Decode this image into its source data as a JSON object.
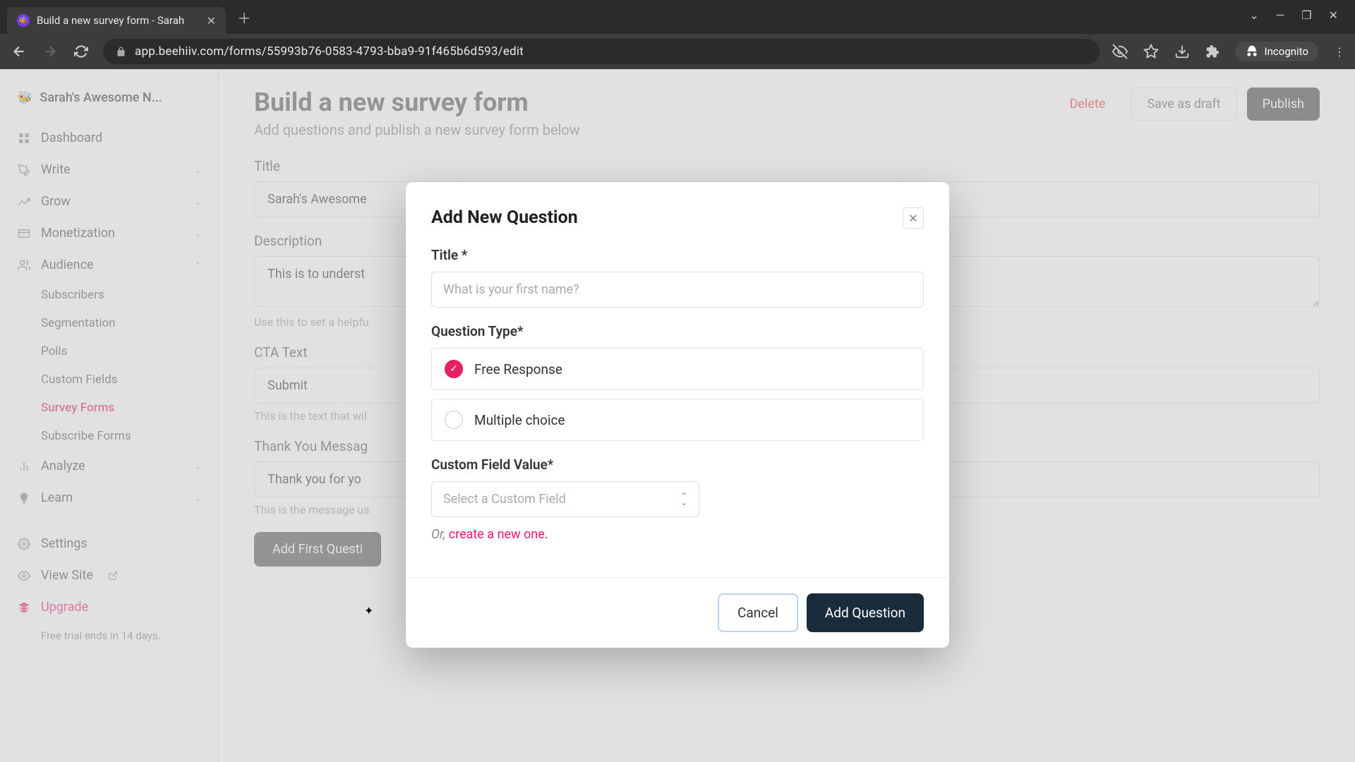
{
  "browser": {
    "tab_title": "Build a new survey form - Sarah",
    "url": "app.beehiiv.com/forms/55993b76-0583-4793-bba9-91f465b6d593/edit",
    "incognito_label": "Incognito"
  },
  "sidebar": {
    "workspace": "Sarah's Awesome N...",
    "items": [
      {
        "label": "Dashboard"
      },
      {
        "label": "Write"
      },
      {
        "label": "Grow"
      },
      {
        "label": "Monetization"
      },
      {
        "label": "Audience"
      }
    ],
    "audience_subitems": [
      {
        "label": "Subscribers"
      },
      {
        "label": "Segmentation"
      },
      {
        "label": "Polls"
      },
      {
        "label": "Custom Fields"
      },
      {
        "label": "Survey Forms",
        "active": true
      },
      {
        "label": "Subscribe Forms"
      }
    ],
    "bottom_items": [
      {
        "label": "Analyze"
      },
      {
        "label": "Learn"
      }
    ],
    "settings_label": "Settings",
    "view_site_label": "View Site",
    "upgrade_label": "Upgrade",
    "trial_text": "Free trial ends in 14 days."
  },
  "page": {
    "title": "Build a new survey form",
    "subtitle": "Add questions and publish a new survey form below",
    "actions": {
      "delete": "Delete",
      "draft": "Save as draft",
      "publish": "Publish"
    },
    "fields": {
      "title_label": "Title",
      "title_value": "Sarah's Awesome",
      "desc_label": "Description",
      "desc_value": "This is to underst",
      "desc_hint": "Use this to set a helpfu",
      "cta_label": "CTA Text",
      "cta_value": "Submit",
      "cta_hint": "This is the text that wil",
      "thanks_label": "Thank You Messag",
      "thanks_value": "Thank you for yo",
      "thanks_hint": "This is the message us"
    },
    "add_first_question": "Add First Questi"
  },
  "modal": {
    "title": "Add New Question",
    "title_label": "Title *",
    "title_placeholder": "What is your first name?",
    "qtype_label": "Question Type*",
    "option_free": "Free Response",
    "option_multiple": "Multiple choice",
    "custom_field_label": "Custom Field Value*",
    "custom_field_placeholder": "Select a Custom Field",
    "or_text": "Or, ",
    "create_link": "create a new one.",
    "cancel": "Cancel",
    "add": "Add Question"
  }
}
